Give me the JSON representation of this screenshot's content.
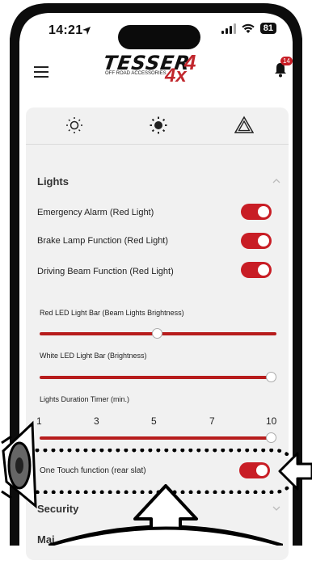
{
  "status": {
    "time": "14:21",
    "battery": "81"
  },
  "header": {
    "logo_main": "TESSER",
    "logo_sub": "OFF ROAD ACCESSORIES",
    "logo_suffix": "4x",
    "notification_count": "14"
  },
  "modes": [
    {
      "icon": "sun-outline-icon"
    },
    {
      "icon": "sun-filled-icon"
    },
    {
      "icon": "warning-triangle-icon"
    }
  ],
  "lights": {
    "title": "Lights",
    "toggles": [
      {
        "label": "Emergency Alarm (Red Light)",
        "on": true
      },
      {
        "label": "Brake Lamp Function (Red Light)",
        "on": true
      },
      {
        "label": "Driving Beam Function (Red Light)",
        "on": true
      }
    ],
    "sliders": [
      {
        "label": "Red LED Light Bar (Beam Lights Brightness)",
        "level": 0.5
      },
      {
        "label": "White LED Light Bar (Brightness)",
        "level": 1.0
      },
      {
        "label": "Lights Duration Timer (min.)",
        "level": 1.0,
        "ticks": [
          "1",
          "3",
          "5",
          "7",
          "10"
        ]
      }
    ],
    "one_touch": {
      "label": "One Touch function (rear slat)",
      "on": true
    }
  },
  "security": {
    "title": "Security"
  },
  "maintenance": {
    "title": "Mai"
  },
  "colors": {
    "accent": "#c81d25",
    "panel": "#f1f1f1"
  }
}
